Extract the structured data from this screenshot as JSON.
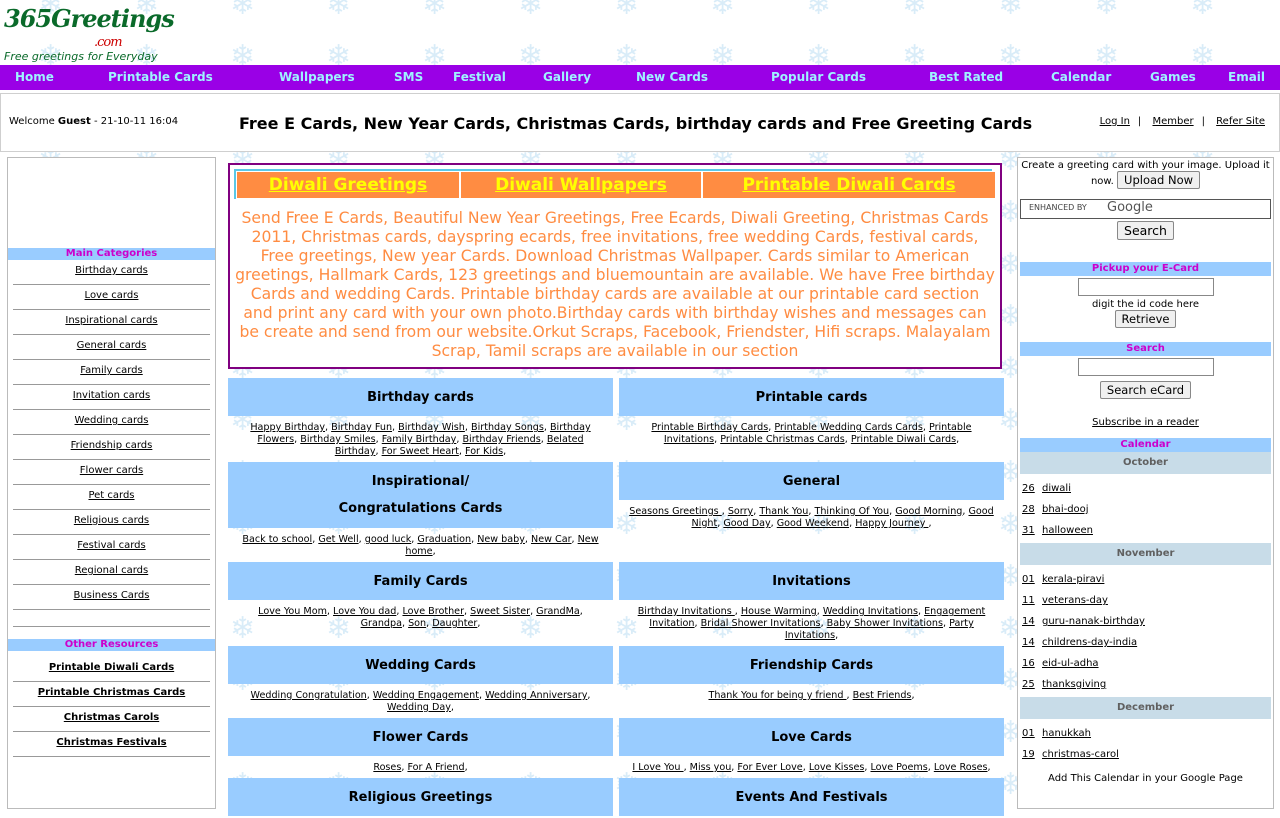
{
  "logo": {
    "title": "365Greetings",
    "com": ".com",
    "tagline": "Free greetings for Everyday"
  },
  "nav": [
    "Home",
    "Printable Cards",
    "Wallpapers",
    "SMS",
    "Festival",
    "Gallery",
    "New Cards",
    "Popular Cards",
    "Best Rated",
    "Calendar",
    "Games",
    "Email"
  ],
  "welcome": {
    "prefix": "Welcome ",
    "user": "Guest",
    "datetime": " - 21-10-11 16:04",
    "headline": "Free E Cards, New Year Cards, Christmas Cards, birthday cards and Free Greeting Cards",
    "login": "Log In",
    "member": "Member",
    "refer": "Refer Site",
    "sep": "|"
  },
  "left": {
    "main_title": "Main Categories",
    "main_items": [
      "Birthday cards",
      "Love cards",
      "Inspirational cards",
      "General cards",
      "Family cards",
      "Invitation cards",
      "Wedding cards",
      "Friendship cards",
      "Flower cards",
      "Pet cards",
      "Religious cards",
      "Festival cards",
      "Regional cards",
      "Business Cards"
    ],
    "other_title": "Other Resources",
    "other_items": [
      "Printable Diwali Cards",
      "Printable Christmas Cards",
      "Christmas Carols",
      "Christmas Festivals"
    ]
  },
  "promo": {
    "tabs": [
      "Diwali Greetings",
      "Diwali Wallpapers",
      "Printable Diwali Cards"
    ],
    "description": "Send Free E Cards, Beautiful New Year Greetings, Free Ecards, Diwali Greeting, Christmas Cards 2011, Christmas cards, dayspring ecards, free invitations, free wedding Cards, festival cards, Free greetings, New year Cards. Download Christmas Wallpaper. Cards similar to American greetings, Hallmark Cards, 123 greetings and bluemountain are available. We have Free birthday Cards and wedding Cards. Printable birthday cards are available at our printable card section and print any card with your own photo.Birthday cards with birthday wishes and messages can be create and send from our website.Orkut Scraps, Facebook, Friendster, Hifi scraps. Malayalam Scrap, Tamil scraps are available in our section"
  },
  "categories": [
    {
      "title": "Birthday cards",
      "links": [
        "Happy Birthday",
        "Birthday Fun",
        "Birthday Wish",
        "Birthday Songs",
        "Birthday Flowers",
        "Birthday Smiles",
        "Family Birthday",
        "Birthday Friends",
        "Belated Birthday",
        "For Sweet Heart",
        "For Kids"
      ]
    },
    {
      "title": "Printable cards",
      "links": [
        "Printable Birthday Cards",
        "Printable Wedding Cards Cards",
        "Printable Invitations",
        "Printable Christmas Cards",
        "Printable Diwali Cards"
      ]
    },
    {
      "title": "Inspirational/",
      "title2": "Congratulations Cards",
      "links": [
        "Back to school",
        "Get Well",
        "good luck",
        "Graduation",
        "New baby",
        "New Car",
        "New home"
      ]
    },
    {
      "title": "General",
      "links": [
        "Seasons Greetings ",
        "Sorry",
        "Thank You",
        "Thinking Of You",
        "Good Morning",
        "Good Night",
        "Good Day",
        "Good Weekend",
        "Happy Journey "
      ]
    },
    {
      "title": "Family Cards",
      "links": [
        "Love You Mom",
        "Love You dad",
        "Love Brother",
        "Sweet Sister",
        "GrandMa",
        "Grandpa",
        "Son",
        "Daughter"
      ]
    },
    {
      "title": "Invitations",
      "links": [
        "Birthday Invitations ",
        "House Warming",
        "Wedding Invitations",
        "Engagement Invitation",
        "Bridal Shower Invitations",
        "Baby Shower Invitations",
        "Party Invitations"
      ]
    },
    {
      "title": "Wedding Cards",
      "links": [
        "Wedding Congratulation",
        "Wedding Engagement",
        "Wedding Anniversary",
        "Wedding Day"
      ]
    },
    {
      "title": "Friendship Cards",
      "links": [
        "Thank You for being y friend ",
        "Best Friends"
      ]
    },
    {
      "title": "Flower Cards",
      "links": [
        "Roses",
        "For A Friend"
      ]
    },
    {
      "title": "Love Cards",
      "links": [
        "I Love You ",
        "Miss you",
        "For Ever Love",
        "Love Kisses",
        "Love Poems",
        "Love Roses"
      ]
    },
    {
      "title": "Religious Greetings",
      "links": []
    },
    {
      "title": "Events And Festivals",
      "links": []
    }
  ],
  "right": {
    "upload_text": "Create a greeting card with your image. Upload it now.",
    "upload_btn": "Upload Now",
    "google_label": "ENHANCED BY",
    "google_brand": "Google",
    "search_btn": "Search",
    "pickup_title": "Pickup your E-Card",
    "pickup_hint": "digit the id code here",
    "retrieve_btn": "Retrieve",
    "search_title": "Search",
    "search_ecard_btn": "Search eCard",
    "subscribe": "Subscribe in a reader",
    "calendar_title": "Calendar",
    "months": [
      {
        "name": "October",
        "events": [
          [
            "26",
            "diwali"
          ],
          [
            "28",
            "bhai-dooj"
          ],
          [
            "31",
            "halloween"
          ]
        ]
      },
      {
        "name": "November",
        "events": [
          [
            "01",
            "kerala-piravi"
          ],
          [
            "11",
            "veterans-day"
          ],
          [
            "14",
            "guru-nanak-birthday"
          ],
          [
            "14",
            "childrens-day-india"
          ],
          [
            "16",
            "eid-ul-adha"
          ],
          [
            "25",
            "thanksgiving"
          ]
        ]
      },
      {
        "name": "December",
        "events": [
          [
            "01",
            "hanukkah"
          ],
          [
            "19",
            "christmas-carol"
          ]
        ]
      }
    ],
    "calendar_note": "Add This Calendar in your Google Page"
  }
}
